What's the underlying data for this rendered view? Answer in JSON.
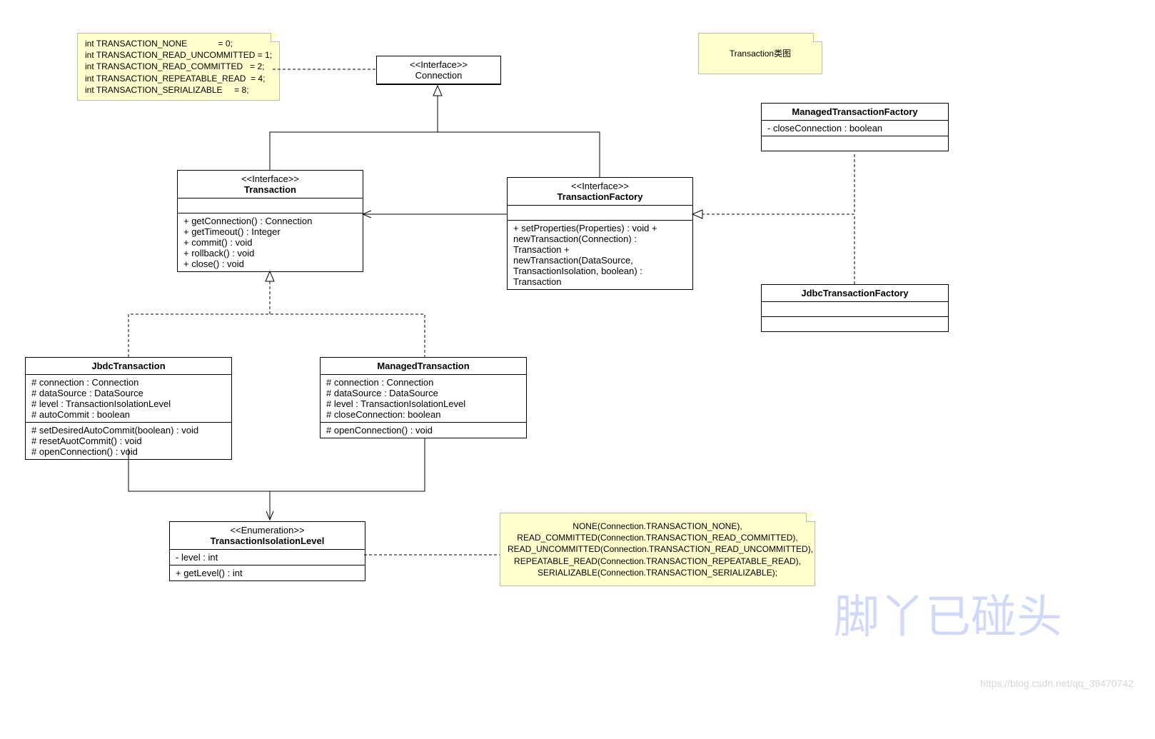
{
  "notes": {
    "constants": "int TRANSACTION_NONE             = 0;\nint TRANSACTION_READ_UNCOMMITTED = 1;\nint TRANSACTION_READ_COMMITTED   = 2;\nint TRANSACTION_REPEATABLE_READ  = 4;\nint TRANSACTION_SERIALIZABLE     = 8;",
    "title": "Transaction类图",
    "enums": "NONE(Connection.TRANSACTION_NONE),\nREAD_COMMITTED(Connection.TRANSACTION_READ_COMMITTED),\nREAD_UNCOMMITTED(Connection.TRANSACTION_READ_UNCOMMITTED),\nREPEATABLE_READ(Connection.TRANSACTION_REPEATABLE_READ),\nSERIALIZABLE(Connection.TRANSACTION_SERIALIZABLE);"
  },
  "connection": {
    "stereo": "<<Interface>>",
    "name": "Connection"
  },
  "transaction": {
    "stereo": "<<Interface>>",
    "name": "Transaction",
    "ops": "+ getConnection() : Connection\n+ getTimeout() : Integer\n+ commit() : void\n+ rollback() : void\n+ close() : void"
  },
  "transactionFactory": {
    "stereo": "<<Interface>>",
    "name": "TransactionFactory",
    "ops": "+ setProperties(Properties) : void\n+ newTransaction(Connection) : Transaction\n+ newTransaction(DataSource, TransactionIsolation, boolean) : Transaction"
  },
  "managedTxFactory": {
    "name": "ManagedTransactionFactory",
    "attrs": "- closeConnection : boolean"
  },
  "jdbcTxFactory": {
    "name": "JdbcTransactionFactory"
  },
  "jbdcTransaction": {
    "name": "JbdcTransaction",
    "attrs": "# connection : Connection\n# dataSource : DataSource\n# level : TransactionIsolationLevel\n# autoCommit : boolean",
    "ops": "# setDesiredAutoCommit(boolean) : void\n# resetAuotCommit() : void\n# openConnection() : void"
  },
  "managedTransaction": {
    "name": "ManagedTransaction",
    "attrs": "# connection : Connection\n# dataSource : DataSource\n# level : TransactionIsolationLevel\n# closeConnection: boolean",
    "ops": "# openConnection() : void"
  },
  "isolationLevel": {
    "stereo": "<<Enumeration>>",
    "name": "TransactionIsolationLevel",
    "attrs": "- level : int",
    "ops": "+ getLevel() : int"
  },
  "watermark": "脚丫已碰头",
  "watermark2": "https://blog.csdn.net/qq_39470742"
}
